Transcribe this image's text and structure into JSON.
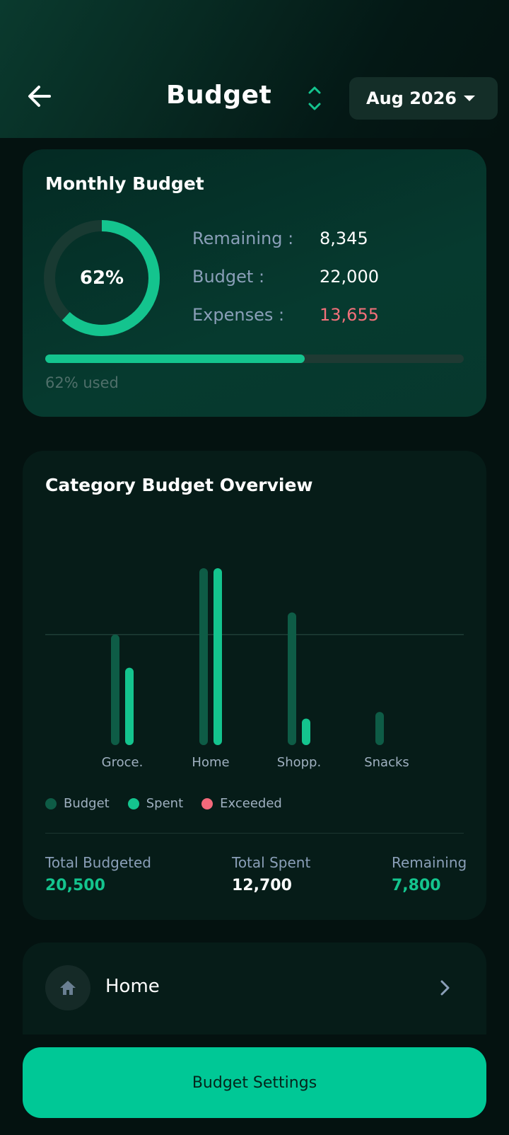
{
  "header": {
    "title": "Budget",
    "month": "Aug 2026",
    "back_icon": "arrow-left-icon",
    "sort_icon": "sort-updown-icon",
    "accent": "#14c48e"
  },
  "monthly_budget": {
    "title": "Monthly Budget",
    "percent_label": "62%",
    "used_fraction": 0.62,
    "remaining_label": "Remaining :",
    "remaining_value": "8,345",
    "budget_label": "Budget :",
    "budget_value": "22,000",
    "expenses_label": "Expenses :",
    "expenses_value": "13,655",
    "used_text": "62% used"
  },
  "category_overview": {
    "title": "Category Budget Overview",
    "legend": [
      {
        "label": "Budget",
        "color": "#0e5c46"
      },
      {
        "label": "Spent",
        "color": "#14c48e"
      },
      {
        "label": "Exceeded",
        "color": "#f2697a"
      }
    ],
    "totals": {
      "budgeted_label": "Total Budgeted",
      "budgeted_value": "20,500",
      "spent_label": "Total Spent",
      "spent_value": "12,700",
      "remaining_label": "Remaining",
      "remaining_value": "7,800"
    }
  },
  "chart_data": {
    "type": "bar",
    "categories": [
      "Groce.",
      "Home",
      "Shopp.",
      "Snacks"
    ],
    "series": [
      {
        "name": "Budget",
        "values": [
          5000,
          8000,
          6000,
          1500
        ]
      },
      {
        "name": "Spent",
        "values": [
          3500,
          8000,
          1200,
          0
        ]
      }
    ],
    "reference_line": 5000,
    "ylim": [
      0,
      8000
    ],
    "grid": false,
    "legend_position": "bottom-left"
  },
  "category_list": {
    "items": [
      {
        "label": "Home",
        "icon": "home-icon"
      }
    ]
  },
  "footer": {
    "settings_label": "Budget Settings"
  }
}
